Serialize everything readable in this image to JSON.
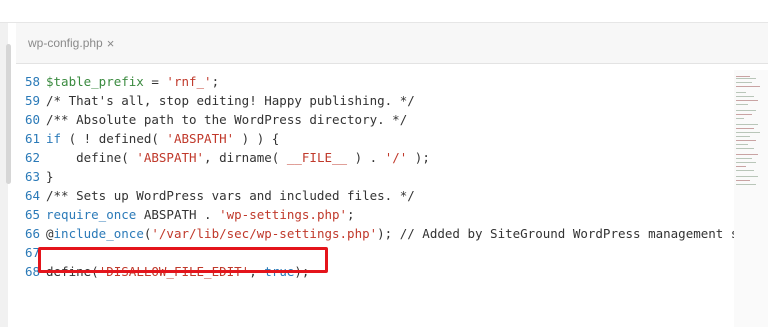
{
  "tab": {
    "filename": "wp-config.php",
    "close_glyph": "×"
  },
  "code": {
    "lines": [
      {
        "num": "58",
        "parts": [
          {
            "t": "$table_prefix",
            "c": "var"
          },
          {
            "t": " = ",
            "c": ""
          },
          {
            "t": "'rnf_'",
            "c": "str"
          },
          {
            "t": ";",
            "c": ""
          }
        ]
      },
      {
        "num": "59",
        "parts": [
          {
            "t": "/* That's all, stop editing! Happy publishing. */",
            "c": "cm"
          }
        ]
      },
      {
        "num": "60",
        "parts": [
          {
            "t": "/** Absolute path to the WordPress directory. */",
            "c": "cm"
          }
        ]
      },
      {
        "num": "61",
        "parts": [
          {
            "t": "if",
            "c": "kw"
          },
          {
            "t": " ( ! defined( ",
            "c": ""
          },
          {
            "t": "'ABSPATH'",
            "c": "str"
          },
          {
            "t": " ) ) {",
            "c": ""
          }
        ]
      },
      {
        "num": "62",
        "parts": [
          {
            "t": "    define( ",
            "c": ""
          },
          {
            "t": "'ABSPATH'",
            "c": "str"
          },
          {
            "t": ", dirname( ",
            "c": ""
          },
          {
            "t": "__FILE__",
            "c": "str"
          },
          {
            "t": " ) . ",
            "c": ""
          },
          {
            "t": "'/'",
            "c": "str"
          },
          {
            "t": " );",
            "c": ""
          }
        ]
      },
      {
        "num": "63",
        "parts": [
          {
            "t": "}",
            "c": ""
          }
        ]
      },
      {
        "num": "64",
        "parts": [
          {
            "t": "/** Sets up WordPress vars and included files. */",
            "c": "cm"
          }
        ]
      },
      {
        "num": "65",
        "parts": [
          {
            "t": "require_once",
            "c": "kw"
          },
          {
            "t": " ABSPATH . ",
            "c": ""
          },
          {
            "t": "'wp-settings.php'",
            "c": "str"
          },
          {
            "t": ";",
            "c": ""
          }
        ]
      },
      {
        "num": "66",
        "parts": [
          {
            "t": "@",
            "c": ""
          },
          {
            "t": "include_once",
            "c": "kw"
          },
          {
            "t": "(",
            "c": ""
          },
          {
            "t": "'/var/lib/sec/wp-settings.php'",
            "c": "str"
          },
          {
            "t": "); // Added by SiteGround WordPress management sy",
            "c": ""
          }
        ]
      },
      {
        "num": "67",
        "parts": []
      },
      {
        "num": "68",
        "parts": [
          {
            "t": "define(",
            "c": ""
          },
          {
            "t": "'DISALLOW_FILE_EDIT'",
            "c": "str"
          },
          {
            "t": ", ",
            "c": ""
          },
          {
            "t": "true",
            "c": "kw"
          },
          {
            "t": ");",
            "c": ""
          }
        ]
      }
    ]
  },
  "colors": {
    "keyword": "#2b7ab8",
    "string": "#c0392b",
    "variable": "#3a8a3f",
    "highlight_border": "#e4141b"
  }
}
